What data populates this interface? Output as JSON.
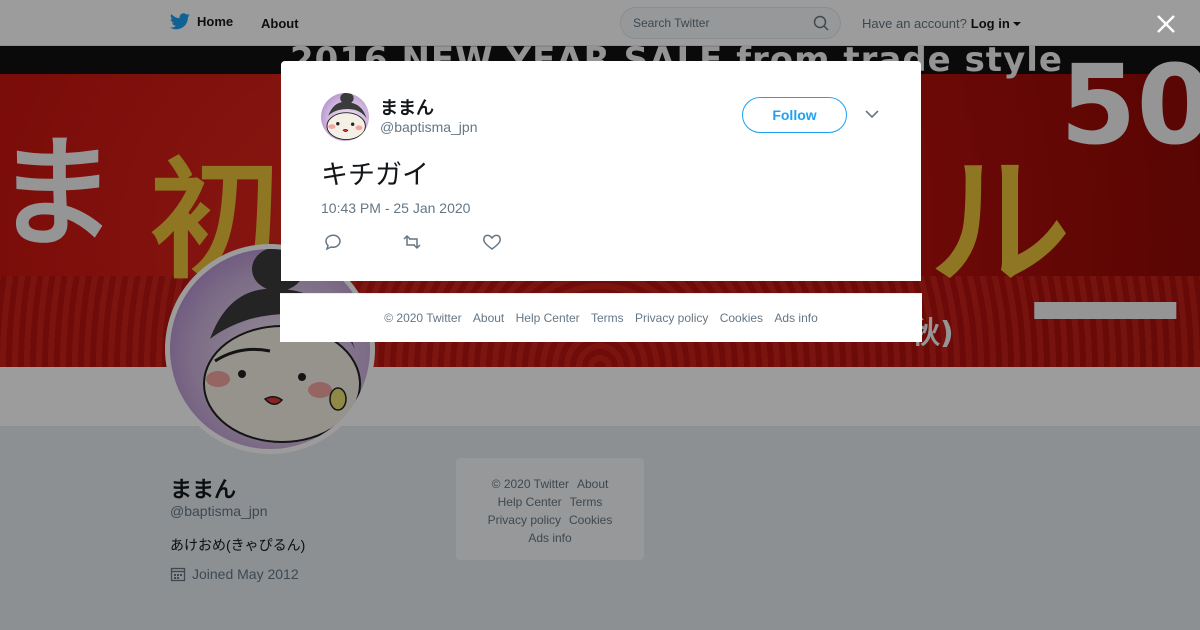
{
  "topbar": {
    "home_label": "Home",
    "about_label": "About",
    "search_placeholder": "Search Twitter",
    "account_prompt": "Have an account?",
    "login_label": "Log in"
  },
  "banner": {
    "headline": "2016 NEW YEAR SALE from trade style",
    "glyph_1": "ま",
    "glyph_2": "初",
    "glyph_3": "ル",
    "glyph_4": "50",
    "glyph_5": "一",
    "glyph_6": "秋)"
  },
  "profile": {
    "name": "ままん",
    "handle": "@baptisma_jpn",
    "bio": "あけおめ(きゃぴるん)",
    "joined": "Joined May 2012"
  },
  "side_footer": {
    "copyright": "© 2020 Twitter",
    "about": "About",
    "help": "Help Center",
    "terms": "Terms",
    "privacy": "Privacy policy",
    "cookies": "Cookies",
    "ads": "Ads info"
  },
  "tweet": {
    "author_name": "ままん",
    "author_handle": "@baptisma_jpn",
    "follow_label": "Follow",
    "text": "キチガイ",
    "timestamp": "10:43 PM - 25 Jan 2020"
  },
  "modal_footer": {
    "copyright": "© 2020 Twitter",
    "about": "About",
    "help": "Help Center",
    "terms": "Terms",
    "privacy": "Privacy policy",
    "cookies": "Cookies",
    "ads": "Ads info"
  },
  "colors": {
    "brand": "#1da1f2",
    "text_primary": "#14171a",
    "text_secondary": "#657786",
    "banner_red": "#c8140f"
  },
  "icons": [
    "twitter-bird-icon",
    "search-icon",
    "caret-down-icon",
    "close-icon",
    "calendar-icon",
    "chevron-down-icon",
    "reply-icon",
    "retweet-icon",
    "like-icon"
  ]
}
